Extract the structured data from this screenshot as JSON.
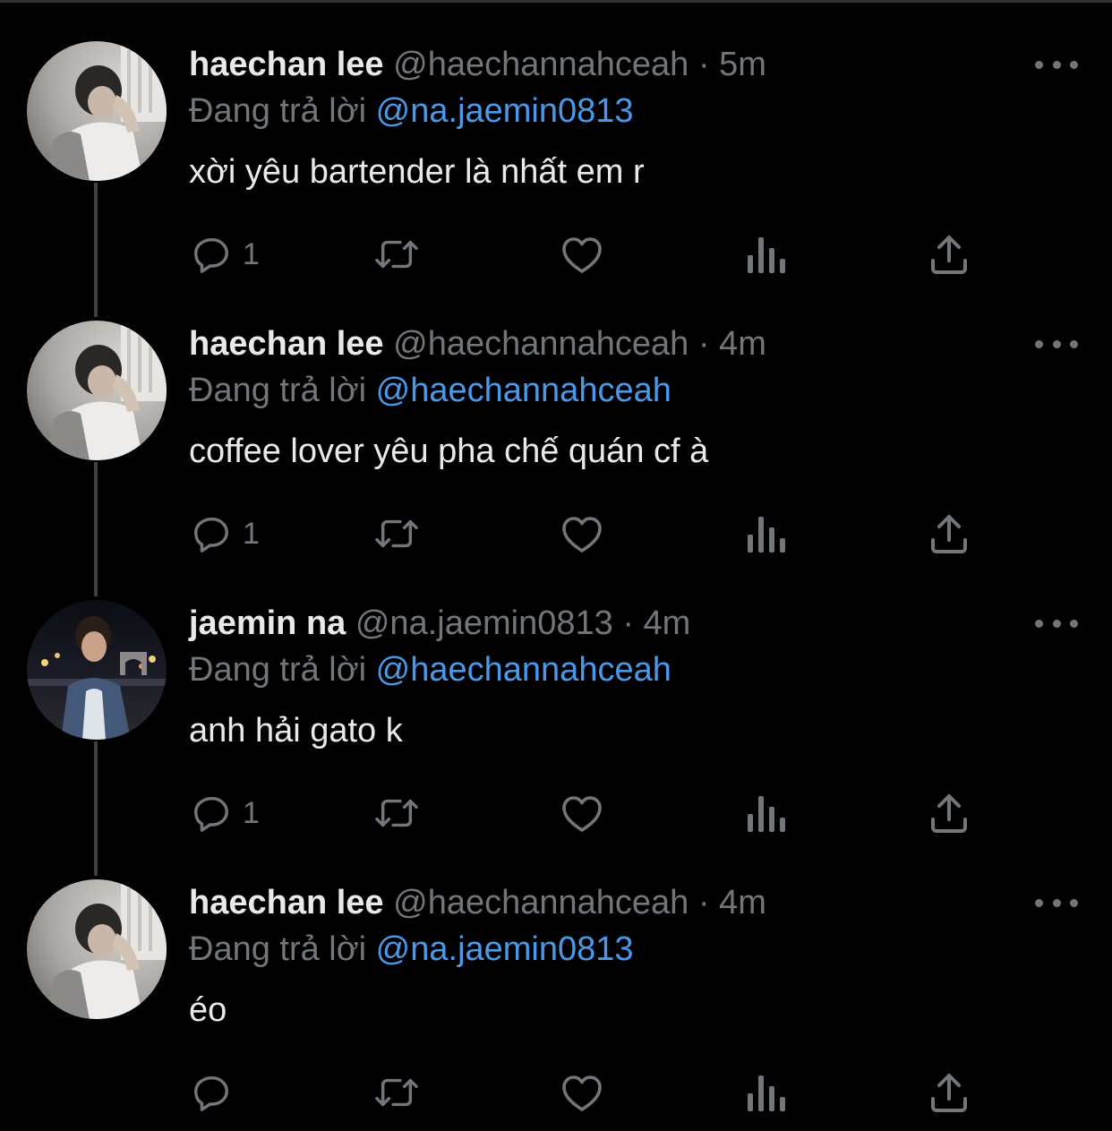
{
  "colors": {
    "background": "#000000",
    "text_primary": "#e7e9ea",
    "text_secondary": "#71767b",
    "mention": "#4a99e9",
    "thread_line": "#3e4144"
  },
  "thread": [
    {
      "display_name": "haechan lee",
      "handle": "@haechannahceah",
      "separator": "·",
      "time": "5m",
      "reply_prefix": "Đang trả lời",
      "reply_to": "@na.jaemin0813",
      "text": "xời yêu bartender là nhất em r",
      "reply_count": "1",
      "avatar": "haechan-avatar"
    },
    {
      "display_name": "haechan lee",
      "handle": "@haechannahceah",
      "separator": "·",
      "time": "4m",
      "reply_prefix": "Đang trả lời",
      "reply_to": "@haechannahceah",
      "text": "coffee lover yêu pha chế quán cf à",
      "reply_count": "1",
      "avatar": "haechan-avatar"
    },
    {
      "display_name": "jaemin na",
      "handle": "@na.jaemin0813",
      "separator": "·",
      "time": "4m",
      "reply_prefix": "Đang trả lời",
      "reply_to": "@haechannahceah",
      "text": "anh hải gato k",
      "reply_count": "1",
      "avatar": "jaemin-avatar"
    },
    {
      "display_name": "haechan lee",
      "handle": "@haechannahceah",
      "separator": "·",
      "time": "4m",
      "reply_prefix": "Đang trả lời",
      "reply_to": "@na.jaemin0813",
      "text": "éo",
      "reply_count": "",
      "avatar": "haechan-avatar"
    }
  ],
  "icons": {
    "more": "more-horizontal-icon",
    "reply": "reply-bubble-icon",
    "retweet": "retweet-icon",
    "like": "heart-icon",
    "views": "views-chart-icon",
    "share": "share-upload-icon"
  }
}
